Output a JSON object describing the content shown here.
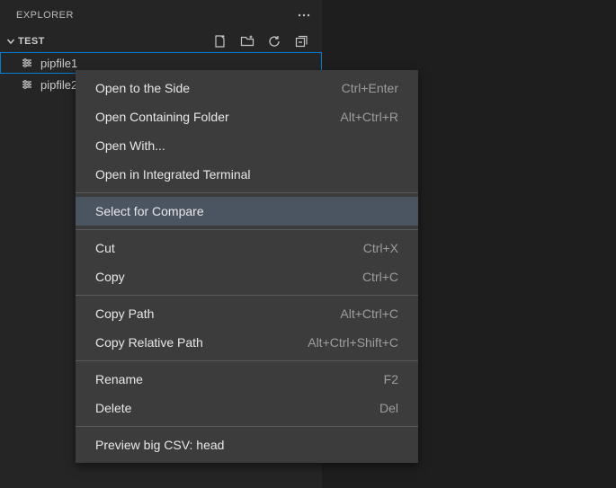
{
  "explorer": {
    "title": "EXPLORER",
    "section_label": "TEST",
    "toolbar": {
      "new_file_title": "New File",
      "new_folder_title": "New Folder",
      "refresh_title": "Refresh Explorer",
      "collapse_title": "Collapse Folders"
    },
    "files": [
      {
        "name": "pipfile1",
        "icon": "settings-gear-icon",
        "selected": true
      },
      {
        "name": "pipfile2",
        "icon": "settings-gear-icon",
        "selected": false
      }
    ]
  },
  "context_menu": {
    "groups": [
      [
        {
          "label": "Open to the Side",
          "shortcut": "Ctrl+Enter",
          "hovered": false
        },
        {
          "label": "Open Containing Folder",
          "shortcut": "Alt+Ctrl+R",
          "hovered": false
        },
        {
          "label": "Open With...",
          "shortcut": "",
          "hovered": false
        },
        {
          "label": "Open in Integrated Terminal",
          "shortcut": "",
          "hovered": false
        }
      ],
      [
        {
          "label": "Select for Compare",
          "shortcut": "",
          "hovered": true
        }
      ],
      [
        {
          "label": "Cut",
          "shortcut": "Ctrl+X",
          "hovered": false
        },
        {
          "label": "Copy",
          "shortcut": "Ctrl+C",
          "hovered": false
        }
      ],
      [
        {
          "label": "Copy Path",
          "shortcut": "Alt+Ctrl+C",
          "hovered": false
        },
        {
          "label": "Copy Relative Path",
          "shortcut": "Alt+Ctrl+Shift+C",
          "hovered": false
        }
      ],
      [
        {
          "label": "Rename",
          "shortcut": "F2",
          "hovered": false
        },
        {
          "label": "Delete",
          "shortcut": "Del",
          "hovered": false
        }
      ],
      [
        {
          "label": "Preview big CSV: head",
          "shortcut": "",
          "hovered": false
        }
      ]
    ]
  }
}
